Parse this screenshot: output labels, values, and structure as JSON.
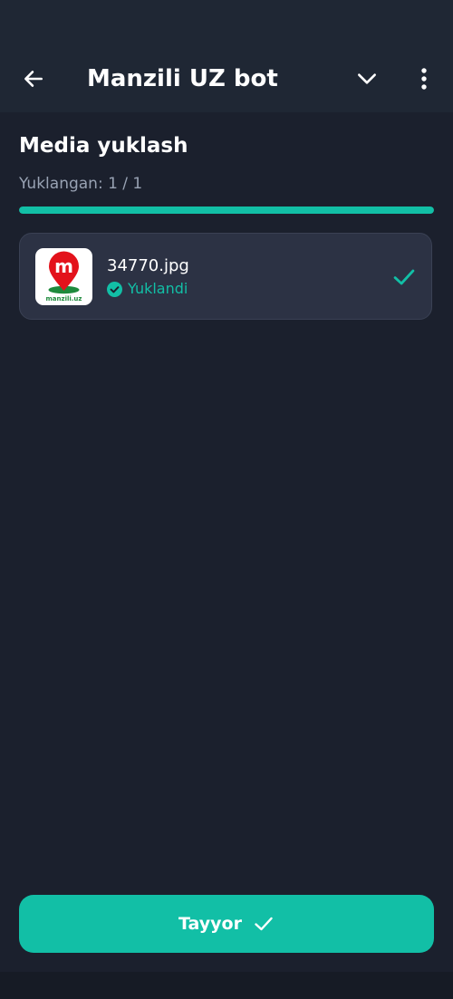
{
  "header": {
    "title": "Manzili UZ bot",
    "back_icon": "arrow-left-icon",
    "collapse_icon": "chevron-down-icon",
    "more_icon": "more-vertical-icon"
  },
  "media": {
    "title": "Media yuklash",
    "progress_label": "Yuklangan: 1 / 1",
    "progress_fraction": 1.0
  },
  "files": [
    {
      "name": "34770.jpg",
      "status": "Yuklandi",
      "thumb_brand": "manzili.uz",
      "thumb_letter": "m"
    }
  ],
  "footer": {
    "done_label": "Tayyor"
  },
  "colors": {
    "background": "#1b202d",
    "header": "#1f2734",
    "accent": "#12bfa6",
    "card": "#2c3244",
    "muted_text": "#98a2b3",
    "brand_red": "#e3121b",
    "brand_green": "#1e8a3c"
  }
}
